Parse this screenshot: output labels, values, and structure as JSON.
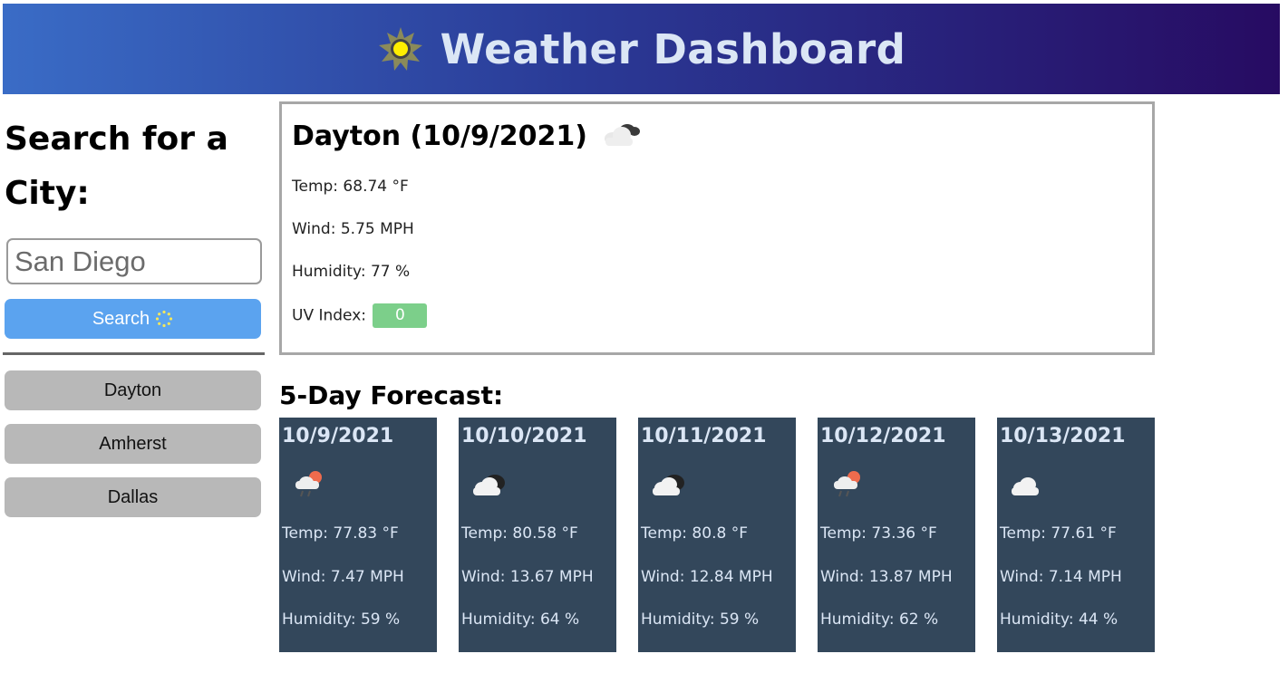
{
  "header": {
    "title": "Weather Dashboard",
    "icon": "sun-icon"
  },
  "sidebar": {
    "heading": "Search for a City:",
    "search_input": {
      "value": "San Diego",
      "placeholder": ""
    },
    "search_button": {
      "label": "Search",
      "icon": "loading-spinner-icon"
    },
    "history": [
      {
        "label": "Dayton"
      },
      {
        "label": "Amherst"
      },
      {
        "label": "Dallas"
      }
    ]
  },
  "current": {
    "title": "Dayton (10/9/2021)",
    "icon": "cloudy-icon",
    "temp": "Temp: 68.74 °F",
    "wind": "Wind: 5.75 MPH",
    "humidity": "Humidity: 77 %",
    "uv_label": "UV Index:",
    "uv_value": "0",
    "uv_color": "#7ccf8a"
  },
  "forecast": {
    "heading": "5-Day Forecast:",
    "days": [
      {
        "date": "10/9/2021",
        "icon": "rain-sun-icon",
        "temp": "Temp: 77.83 °F",
        "wind": "Wind: 7.47 MPH",
        "humidity": "Humidity: 59 %"
      },
      {
        "date": "10/10/2021",
        "icon": "cloudy-icon",
        "temp": "Temp: 80.58 °F",
        "wind": "Wind: 13.67 MPH",
        "humidity": "Humidity: 64 %"
      },
      {
        "date": "10/11/2021",
        "icon": "cloudy-icon",
        "temp": "Temp: 80.8 °F",
        "wind": "Wind: 12.84 MPH",
        "humidity": "Humidity: 59 %"
      },
      {
        "date": "10/12/2021",
        "icon": "rain-sun-icon",
        "temp": "Temp: 73.36 °F",
        "wind": "Wind: 13.87 MPH",
        "humidity": "Humidity: 62 %"
      },
      {
        "date": "10/13/2021",
        "icon": "cloud-icon",
        "temp": "Temp: 77.61 °F",
        "wind": "Wind: 7.14 MPH",
        "humidity": "Humidity: 44 %"
      }
    ]
  },
  "colors": {
    "header_start": "#3a6cc6",
    "header_end": "#270b62",
    "search_button": "#5ba3ef",
    "history_button": "#b8b8b8",
    "forecast_card": "#33475b"
  }
}
